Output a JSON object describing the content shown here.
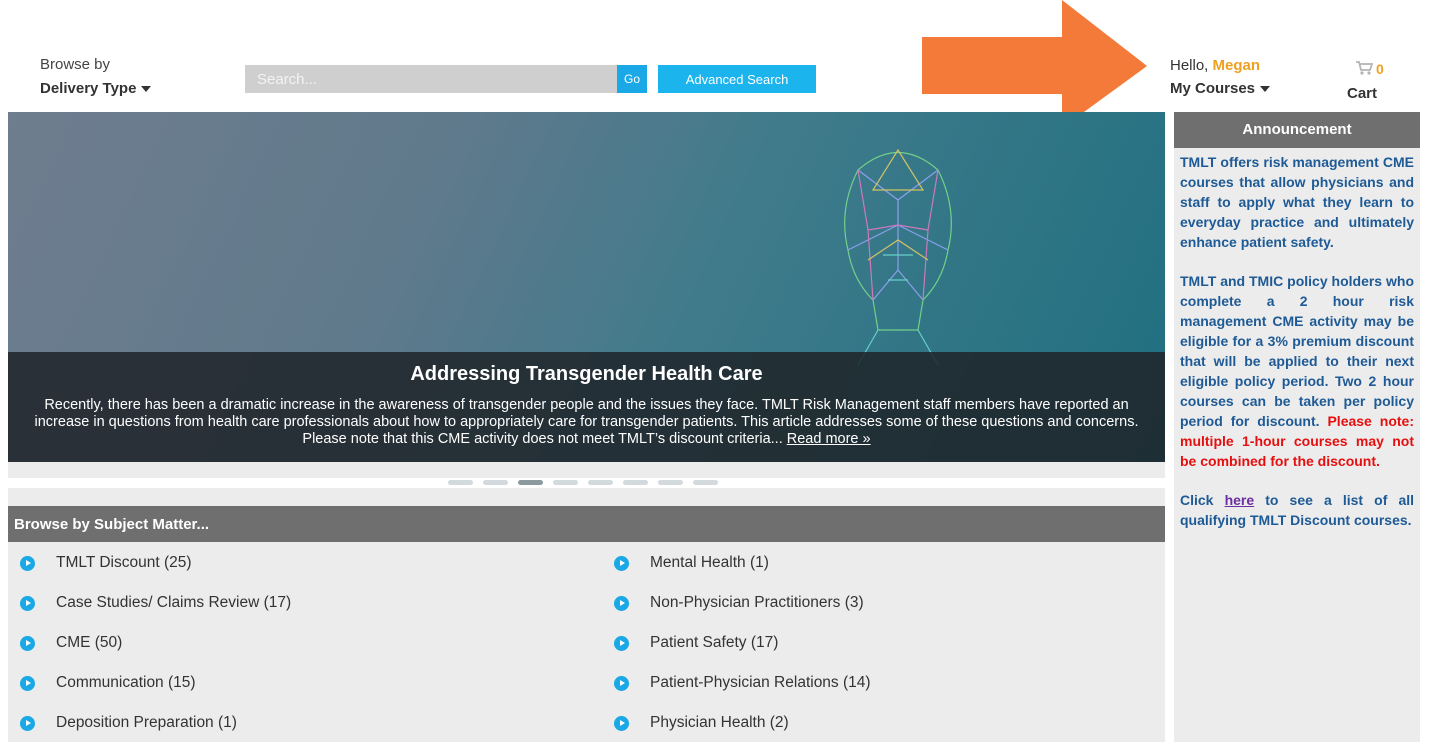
{
  "header": {
    "browse_label": "Browse by",
    "browse_delivery": "Delivery Type",
    "search_placeholder": "Search...",
    "go_label": "Go",
    "advanced_search_label": "Advanced Search",
    "hello_prefix": "Hello,",
    "user_name": "Megan",
    "my_courses_label": "My Courses",
    "cart_count": "0",
    "cart_label": "Cart"
  },
  "hero": {
    "title": "Addressing Transgender Health Care",
    "text": "Recently, there has been a dramatic increase in the awareness of transgender people and the issues they face. TMLT Risk Management staff members have reported an increase in questions from health care professionals about how to appropriately care for transgender patients. This article addresses some of these questions and concerns. Please note that this CME activity does not meet TMLT’s discount criteria...",
    "read_more": "Read more »",
    "slide_count": 8,
    "active_slide": 3
  },
  "subjects": {
    "header": "Browse by Subject Matter...",
    "left": [
      {
        "name": "TMLT Discount",
        "count": "(25)"
      },
      {
        "name": "Case Studies/ Claims Review",
        "count": "(17)"
      },
      {
        "name": "CME",
        "count": "(50)"
      },
      {
        "name": "Communication",
        "count": "(15)"
      },
      {
        "name": "Deposition Preparation",
        "count": "(1)"
      }
    ],
    "right": [
      {
        "name": "Mental Health",
        "count": "(1)"
      },
      {
        "name": "Non-Physician Practitioners",
        "count": "(3)"
      },
      {
        "name": "Patient Safety",
        "count": "(17)"
      },
      {
        "name": "Patient-Physician Relations",
        "count": "(14)"
      },
      {
        "name": "Physician Health",
        "count": "(2)"
      }
    ]
  },
  "announcement": {
    "header": "Announcement",
    "p1": "TMLT offers risk management CME courses that allow physicians and staff to apply what they learn to everyday practice and ultimately enhance patient safety.",
    "p2": "TMLT and TMIC policy holders who complete a 2 hour risk management CME activity may be eligible for a 3% premium discount that will be applied to their next eligible policy period. Two 2 hour courses can be taken per policy period for discount.",
    "p2_note": "Please note: multiple 1-hour courses may not be combined for the discount.",
    "p3_pre": "Click",
    "p3_link": "here",
    "p3_post": "to see a list of all qualifying TMLT Discount courses."
  },
  "colors": {
    "accent_blue": "#1aa9e6",
    "user_orange": "#f0a020",
    "arrow_orange": "#f47a3a",
    "announcement_text": "#1e5a95",
    "note_red": "#e60f0f"
  }
}
